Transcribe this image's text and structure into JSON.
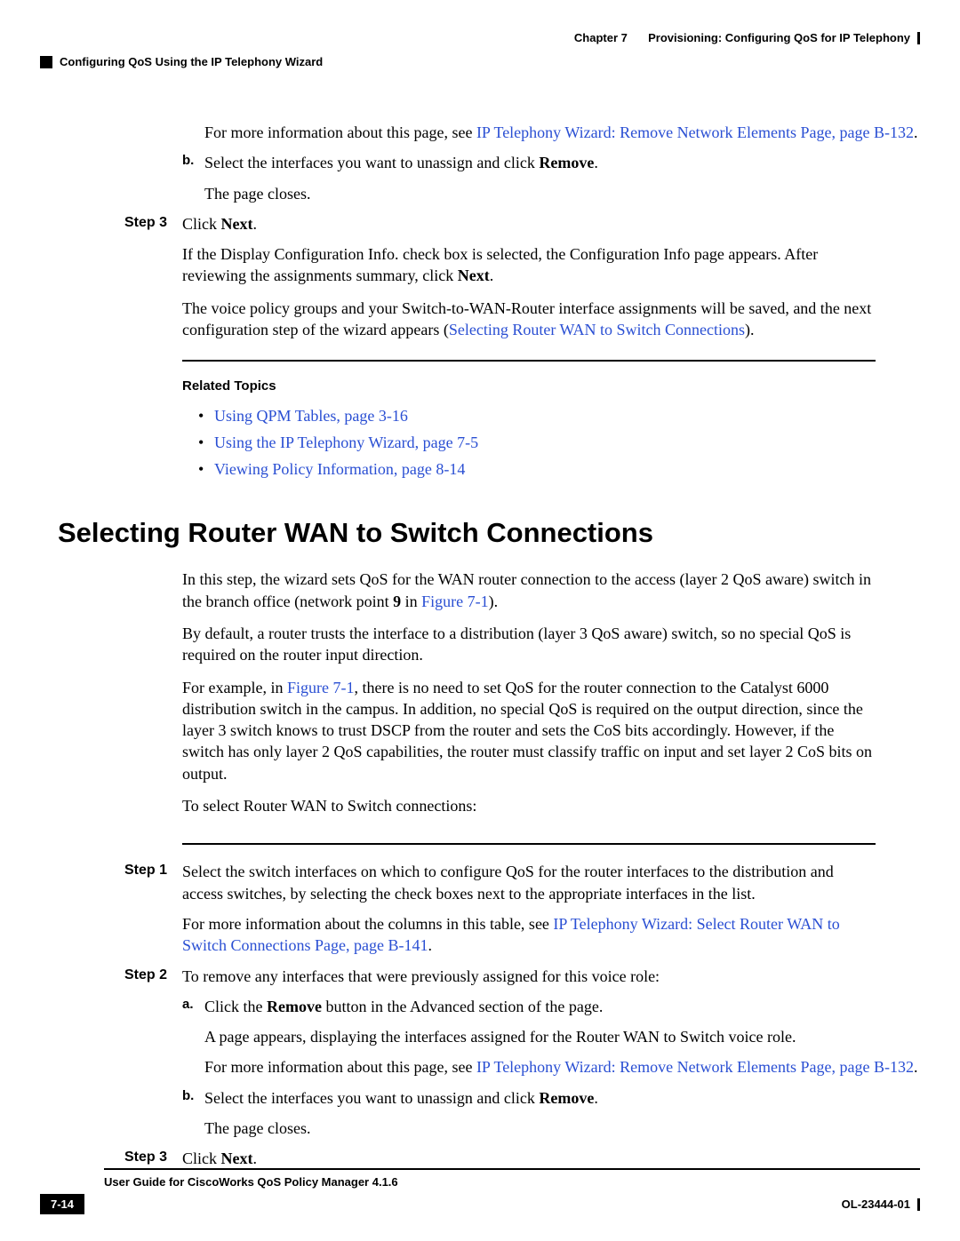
{
  "header": {
    "chapter_label": "Chapter 7",
    "chapter_title": "Provisioning: Configuring QoS for IP Telephony",
    "section_title": "Configuring QoS Using the IP Telephony Wizard"
  },
  "c1": {
    "p1_pre": "For more information about this page, see ",
    "p1_link": "IP Telephony Wizard: Remove Network Elements Page, page B-132",
    "p1_post": ".",
    "b_label": "b.",
    "b_text_pre": "Select the interfaces you want to unassign and click ",
    "b_bold": "Remove",
    "b_text_post": ".",
    "b_close": "The page closes.",
    "step3_label": "Step 3",
    "step3_text_pre": "Click ",
    "step3_bold": "Next",
    "step3_text_post": ".",
    "s3_p1_pre": "If the Display Configuration Info. check box is selected, the Configuration Info page appears. After reviewing the assignments summary, click ",
    "s3_p1_bold": "Next",
    "s3_p1_post": ".",
    "s3_p2_pre": "The voice policy groups and your Switch-to-WAN-Router interface assignments will be saved, and the next configuration step of the wizard appears (",
    "s3_p2_link": "Selecting Router WAN to Switch Connections",
    "s3_p2_post": ")."
  },
  "related": {
    "heading": "Related Topics",
    "bul": "•",
    "t1": "Using QPM Tables, page 3-16",
    "t2": "Using the IP Telephony Wizard, page 7-5",
    "t3": "Viewing Policy Information, page 8-14"
  },
  "h2": "Selecting Router WAN to Switch Connections",
  "s2": {
    "p1_pre": "In this step, the wizard sets QoS for the WAN router connection to the access (layer 2 QoS aware) switch in the branch office (network point ",
    "p1_bold": "9",
    "p1_mid": " in ",
    "p1_link": "Figure 7-1",
    "p1_post": ").",
    "p2": "By default, a router trusts the interface to a distribution (layer 3 QoS aware) switch, so no special QoS is required on the router input direction.",
    "p3_pre": "For example, in ",
    "p3_link": "Figure 7-1",
    "p3_post": ", there is no need to set QoS for the router connection to the Catalyst 6000 distribution switch in the campus. In addition, no special QoS is required on the output direction, since the layer 3 switch knows to trust DSCP from the router and sets the CoS bits accordingly. However, if the switch has only layer 2 QoS capabilities, the router must classify traffic on input and set layer 2 CoS bits on output.",
    "p4": "To select Router WAN to Switch connections:",
    "step1_label": "Step 1",
    "step1_p1": "Select the switch interfaces on which to configure QoS for the router interfaces to the distribution and access switches, by selecting the check boxes next to the appropriate interfaces in the list.",
    "step1_p2_pre": "For more information about the columns in this table, see ",
    "step1_p2_link": "IP Telephony Wizard: Select Router WAN to Switch Connections Page, page B-141",
    "step1_p2_post": ".",
    "step2_label": "Step 2",
    "step2_intro": "To remove any interfaces that were previously assigned for this voice role:",
    "a_label": "a.",
    "a_text_pre": "Click the ",
    "a_bold": "Remove",
    "a_text_post": " button in the Advanced section of the page.",
    "a_p2": "A page appears, displaying the interfaces assigned for the Router WAN to Switch voice role.",
    "a_p3_pre": "For more information about this page, see ",
    "a_p3_link": "IP Telephony Wizard: Remove Network Elements Page, page B-132",
    "a_p3_post": ".",
    "b_label": "b.",
    "b_text_pre": "Select the interfaces you want to unassign and click ",
    "b_bold": "Remove",
    "b_text_post": ".",
    "b_close": "The page closes.",
    "step3_label": "Step 3",
    "step3_text_pre": "Click ",
    "step3_bold": "Next",
    "step3_text_post": "."
  },
  "footer": {
    "book_title": "User Guide for CiscoWorks QoS Policy Manager 4.1.6",
    "page_num": "7-14",
    "doc_id": "OL-23444-01"
  }
}
